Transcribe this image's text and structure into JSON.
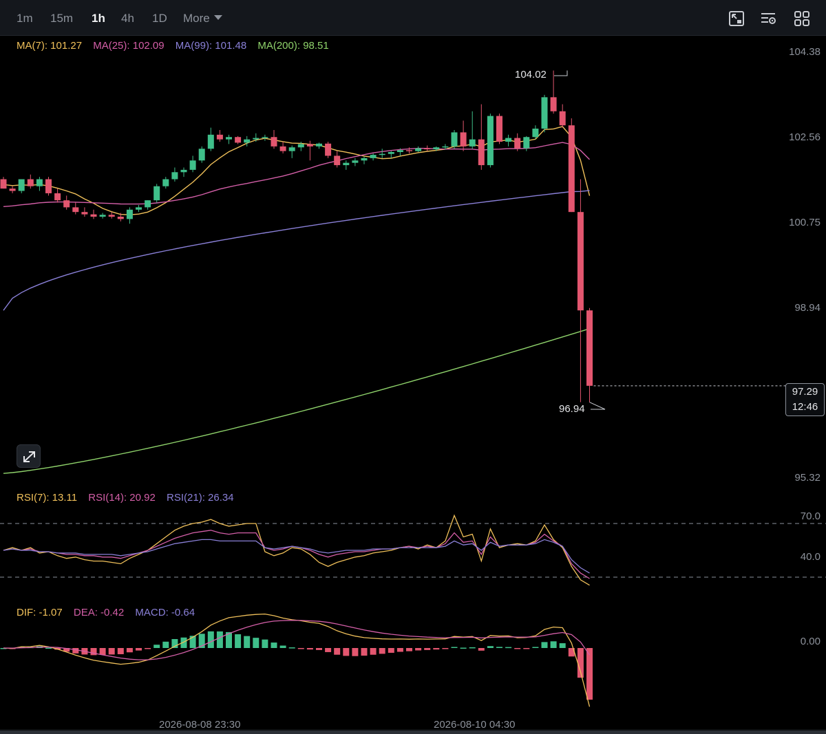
{
  "toolbar": {
    "timeframes": [
      {
        "label": "1m",
        "active": false
      },
      {
        "label": "15m",
        "active": false
      },
      {
        "label": "1h",
        "active": true
      },
      {
        "label": "4h",
        "active": false
      },
      {
        "label": "1D",
        "active": false
      }
    ],
    "more_label": "More",
    "icons": [
      "chart-settings-icon",
      "indicator-settings-icon",
      "grid-layout-icon"
    ]
  },
  "legend": {
    "ma": [
      {
        "label": "MA(7): 101.27",
        "color": "#f0c05a"
      },
      {
        "label": "MA(25): 102.09",
        "color": "#d45fa8"
      },
      {
        "label": "MA(99): 101.48",
        "color": "#8a80d8"
      },
      {
        "label": "MA(200): 98.51",
        "color": "#8fd36b"
      }
    ],
    "rsi": [
      {
        "label": "RSI(7): 13.11",
        "color": "#f0c05a"
      },
      {
        "label": "RSI(14): 20.92",
        "color": "#d45fa8"
      },
      {
        "label": "RSI(21): 26.34",
        "color": "#8a80d8"
      }
    ],
    "macd": [
      {
        "label": "DIF: -1.07",
        "color": "#f0c05a"
      },
      {
        "label": "DEA: -0.42",
        "color": "#d45fa8"
      },
      {
        "label": "MACD: -0.64",
        "color": "#8a80d8"
      }
    ]
  },
  "axis": {
    "price_ticks": [
      "104.38",
      "102.56",
      "100.75",
      "98.94",
      "95.32"
    ],
    "rsi_ticks": [
      "70.0",
      "40.0"
    ],
    "macd_ticks": [
      "0.00"
    ],
    "time_labels": [
      "2026-08-08 23:30",
      "2026-08-10 04:30"
    ]
  },
  "annotations": {
    "high": "104.02",
    "low": "96.94",
    "last_price": "97.29",
    "countdown": "12:46"
  },
  "colors": {
    "up": "#3fbf8a",
    "down": "#e3566f",
    "background": "#000000"
  },
  "chart_data": {
    "type": "candlestick",
    "interval": "1h",
    "price_ylim": [
      95.32,
      104.38
    ],
    "candles": [
      [
        101.7,
        101.75,
        101.5,
        101.5
      ],
      [
        101.5,
        101.55,
        101.4,
        101.45
      ],
      [
        101.45,
        101.7,
        101.4,
        101.7
      ],
      [
        101.7,
        101.8,
        101.5,
        101.55
      ],
      [
        101.55,
        101.75,
        101.45,
        101.7
      ],
      [
        101.7,
        101.75,
        101.35,
        101.4
      ],
      [
        101.4,
        101.5,
        101.2,
        101.25
      ],
      [
        101.25,
        101.35,
        101.05,
        101.1
      ],
      [
        101.1,
        101.2,
        100.95,
        101.0
      ],
      [
        101.0,
        101.1,
        100.9,
        100.95
      ],
      [
        100.95,
        101.05,
        100.85,
        100.9
      ],
      [
        100.9,
        100.98,
        100.86,
        100.94
      ],
      [
        100.94,
        101.0,
        100.86,
        100.9
      ],
      [
        100.9,
        100.98,
        100.8,
        100.85
      ],
      [
        100.85,
        101.1,
        100.75,
        101.05
      ],
      [
        101.05,
        101.15,
        101.0,
        101.1
      ],
      [
        101.1,
        101.25,
        101.05,
        101.25
      ],
      [
        101.25,
        101.6,
        101.2,
        101.55
      ],
      [
        101.55,
        101.75,
        101.5,
        101.7
      ],
      [
        101.7,
        101.95,
        101.65,
        101.85
      ],
      [
        101.85,
        101.95,
        101.75,
        101.9
      ],
      [
        101.9,
        102.2,
        101.85,
        102.1
      ],
      [
        102.1,
        102.4,
        102.05,
        102.35
      ],
      [
        102.35,
        102.8,
        102.3,
        102.65
      ],
      [
        102.65,
        102.75,
        102.5,
        102.55
      ],
      [
        102.55,
        102.65,
        102.45,
        102.6
      ],
      [
        102.6,
        102.62,
        102.45,
        102.48
      ],
      [
        102.48,
        102.62,
        102.4,
        102.55
      ],
      [
        102.55,
        102.68,
        102.5,
        102.58
      ],
      [
        102.58,
        102.65,
        102.52,
        102.6
      ],
      [
        102.6,
        102.75,
        102.35,
        102.4
      ],
      [
        102.4,
        102.5,
        102.25,
        102.3
      ],
      [
        102.3,
        102.42,
        102.15,
        102.38
      ],
      [
        102.38,
        102.5,
        102.3,
        102.45
      ],
      [
        102.45,
        102.52,
        102.1,
        102.4
      ],
      [
        102.4,
        102.48,
        102.35,
        102.46
      ],
      [
        102.46,
        102.5,
        102.15,
        102.2
      ],
      [
        102.2,
        102.3,
        101.95,
        102.0
      ],
      [
        102.0,
        102.1,
        101.9,
        102.05
      ],
      [
        102.05,
        102.15,
        101.98,
        102.1
      ],
      [
        102.1,
        102.18,
        102.02,
        102.15
      ],
      [
        102.15,
        102.25,
        102.1,
        102.22
      ],
      [
        102.22,
        102.35,
        102.15,
        102.24
      ],
      [
        102.24,
        102.3,
        102.15,
        102.28
      ],
      [
        102.28,
        102.36,
        102.2,
        102.32
      ],
      [
        102.32,
        102.38,
        102.25,
        102.3
      ],
      [
        102.3,
        102.4,
        102.28,
        102.36
      ],
      [
        102.36,
        102.42,
        102.3,
        102.34
      ],
      [
        102.34,
        102.4,
        102.3,
        102.38
      ],
      [
        102.38,
        102.45,
        102.33,
        102.4
      ],
      [
        102.4,
        102.75,
        102.35,
        102.7
      ],
      [
        102.7,
        102.95,
        102.3,
        102.4
      ],
      [
        102.4,
        103.15,
        102.35,
        102.55
      ],
      [
        102.55,
        103.3,
        101.9,
        102.0
      ],
      [
        102.0,
        103.1,
        101.95,
        103.05
      ],
      [
        103.05,
        103.1,
        102.45,
        102.5
      ],
      [
        102.5,
        102.65,
        102.4,
        102.58
      ],
      [
        102.58,
        102.68,
        102.3,
        102.36
      ],
      [
        102.36,
        102.62,
        102.3,
        102.6
      ],
      [
        102.6,
        102.85,
        102.55,
        102.78
      ],
      [
        102.78,
        103.5,
        102.7,
        103.45
      ],
      [
        103.45,
        104.02,
        103.1,
        103.15
      ],
      [
        103.15,
        103.3,
        102.8,
        102.85
      ],
      [
        102.85,
        103.0,
        101.0,
        101.0
      ],
      [
        101.0,
        101.7,
        96.94,
        98.9
      ],
      [
        98.9,
        98.95,
        96.94,
        97.29
      ]
    ],
    "ma_series": [
      {
        "name": "MA(7)",
        "last": 101.27
      },
      {
        "name": "MA(25)",
        "last": 102.09
      },
      {
        "name": "MA(99)",
        "last": 101.48
      },
      {
        "name": "MA(200)",
        "last": 98.51
      }
    ],
    "rsi": {
      "ylim": [
        0,
        100
      ],
      "levels": [
        70,
        30
      ],
      "series": [
        {
          "name": "RSI(7)",
          "values": [
            50,
            52,
            50,
            52,
            48,
            49,
            46,
            44,
            45,
            43,
            42,
            42,
            41,
            40,
            44,
            47,
            50,
            55,
            60,
            65,
            68,
            70,
            71,
            73,
            70,
            68,
            69,
            70,
            70,
            49,
            46,
            48,
            52,
            51,
            47,
            41,
            38,
            41,
            43,
            45,
            46,
            48,
            49,
            50,
            52,
            53,
            51,
            54,
            52,
            57,
            76,
            60,
            62,
            42,
            66,
            52,
            54,
            55,
            54,
            57,
            69,
            58,
            52,
            38,
            28,
            24
          ]
        },
        {
          "name": "RSI(14)",
          "values": [
            50,
            51,
            50,
            51,
            49,
            49,
            48,
            47,
            47,
            46,
            46,
            45,
            45,
            44,
            46,
            48,
            50,
            53,
            56,
            59,
            61,
            63,
            64,
            65,
            63,
            62,
            63,
            63,
            63,
            52,
            50,
            51,
            53,
            52,
            50,
            47,
            45,
            47,
            48,
            49,
            49,
            50,
            51,
            51,
            52,
            53,
            52,
            53,
            52,
            55,
            63,
            56,
            57,
            47,
            60,
            53,
            54,
            54,
            54,
            56,
            62,
            57,
            53,
            40,
            33,
            29
          ]
        },
        {
          "name": "RSI(21)",
          "values": [
            50,
            51,
            50,
            50,
            49,
            49,
            48,
            48,
            48,
            47,
            47,
            47,
            47,
            46,
            47,
            48,
            49,
            51,
            53,
            55,
            56,
            57,
            58,
            58,
            57,
            57,
            57,
            57,
            57,
            52,
            51,
            52,
            53,
            52,
            51,
            49,
            48,
            49,
            50,
            50,
            50,
            51,
            51,
            51,
            52,
            52,
            52,
            52,
            52,
            53,
            57,
            54,
            55,
            50,
            56,
            53,
            54,
            54,
            54,
            55,
            58,
            56,
            53,
            43,
            37,
            33
          ]
        }
      ]
    },
    "macd": {
      "ylim": [
        -1.2,
        0.4
      ],
      "dif_last": -1.07,
      "dea_last": -0.42,
      "macd_last": -0.64
    }
  }
}
